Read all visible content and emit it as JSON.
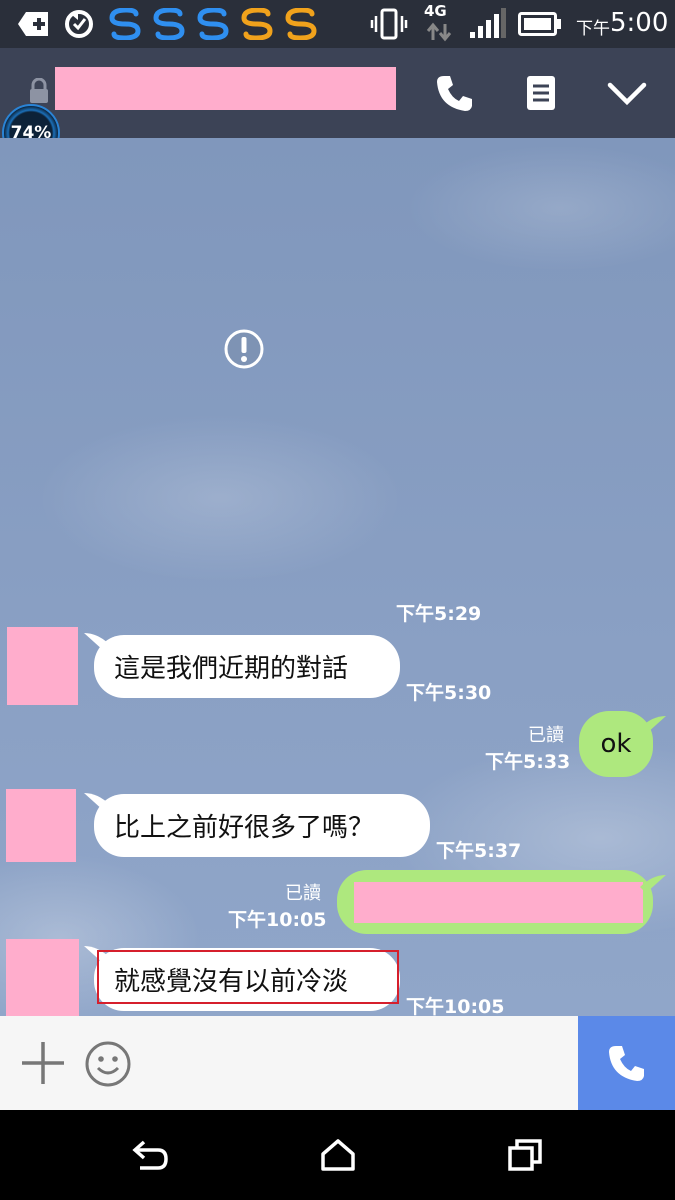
{
  "status_bar": {
    "time": "5:00",
    "time_prefix": "下午",
    "network": "4G",
    "icons": [
      "add-icon",
      "sync-icon",
      "app-icon-blue",
      "app-icon-blue",
      "app-icon-blue",
      "app-icon-orange",
      "app-icon-orange",
      "vibrate-icon",
      "signal-icon",
      "battery-icon"
    ]
  },
  "header": {
    "overlay_badge": "74%",
    "icons": [
      "lock-icon",
      "phone-icon",
      "notes-icon",
      "chevron-down-icon"
    ]
  },
  "chat": {
    "messages": [
      {
        "type": "time",
        "time": "下午5:29"
      },
      {
        "type": "incoming",
        "text": "這是我們近期的對話",
        "time": "下午5:30"
      },
      {
        "type": "outgoing",
        "text": "ok",
        "read": "已讀",
        "time": "下午5:33"
      },
      {
        "type": "incoming",
        "text": "比上之前好很多了嗎？",
        "time": "下午5:37"
      },
      {
        "type": "outgoing",
        "text": "",
        "read": "已讀",
        "time": "下午10:05"
      },
      {
        "type": "incoming",
        "text": "就感覺沒有以前冷淡",
        "time": "下午10:05"
      }
    ]
  },
  "input_bar": {
    "icons": [
      "plus-icon",
      "emoji-icon",
      "call-icon"
    ]
  },
  "colors": {
    "header_bg": "#3c4356",
    "chat_bg": "#8aa0c4",
    "outgoing_bubble": "#aee87e",
    "incoming_bubble": "#ffffff",
    "send_button": "#5b89e8",
    "redaction": "#ffadcc",
    "highlight_box": "#d61f2c"
  }
}
